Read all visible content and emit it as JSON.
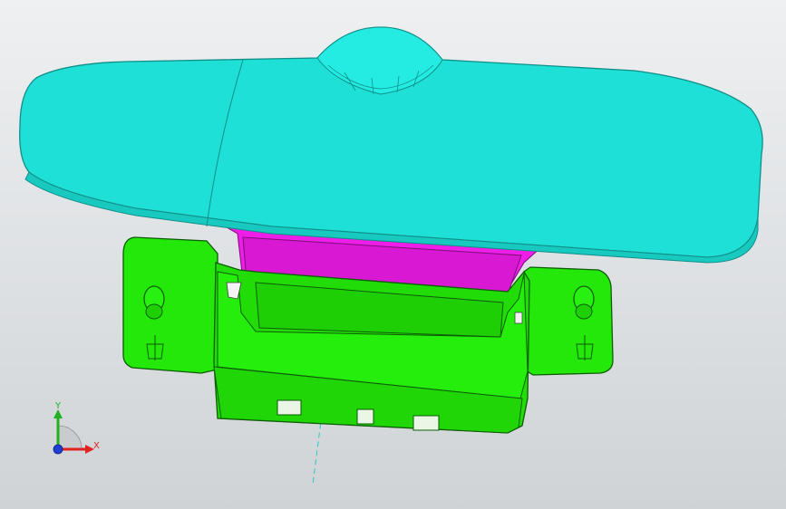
{
  "viewport": {
    "background_top": "#eef0f1",
    "background_bottom": "#cfd3d6"
  },
  "model": {
    "parts": [
      {
        "name": "mirror",
        "color": "#1fe0d6",
        "edge": "#0f8f88"
      },
      {
        "name": "stem",
        "color": "#ee1ee8",
        "edge": "#7a0f77"
      },
      {
        "name": "mount-base",
        "color": "#24e80a",
        "edge": "#0c5c04"
      }
    ]
  },
  "triad": {
    "x_label": "X",
    "y_label": "Y",
    "x_color": "#e0231e",
    "y_color": "#20b020",
    "z_color": "#1d3fd6"
  }
}
